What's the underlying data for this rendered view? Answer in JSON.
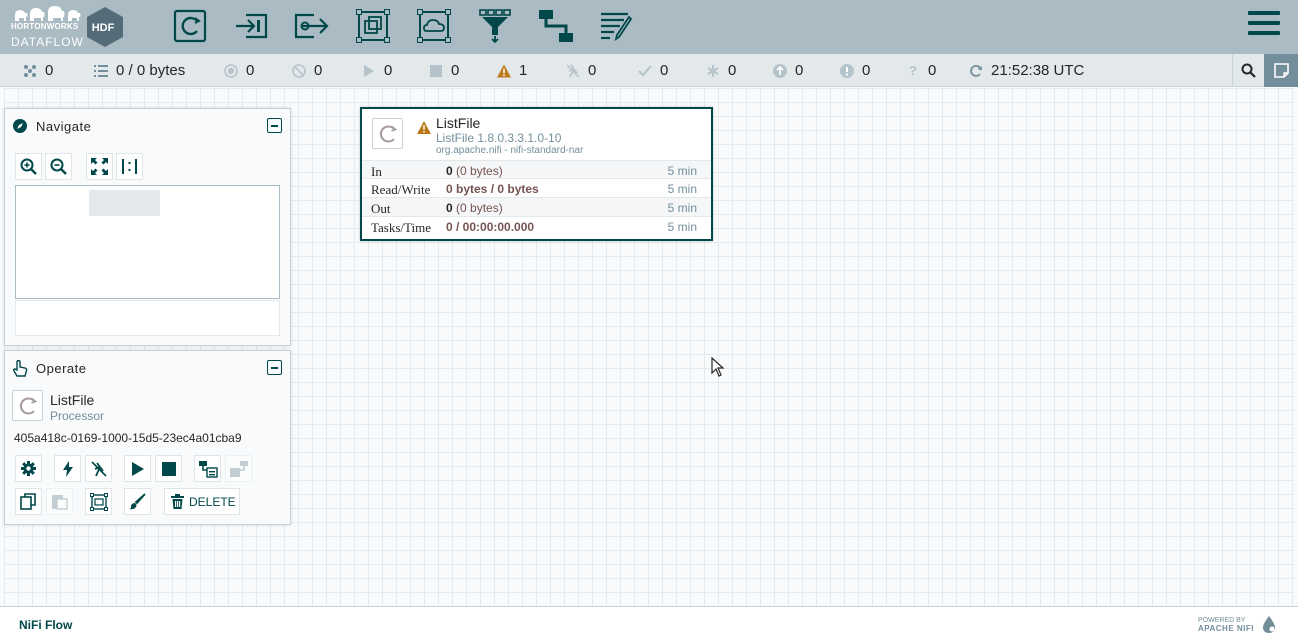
{
  "header": {
    "logo_company": "HORTONWORKS",
    "logo_product": "DATAFLOW",
    "logo_badge": "HDF",
    "toolbar": [
      {
        "name": "processor-tool",
        "icon": "processor-icon"
      },
      {
        "name": "input-port-tool",
        "icon": "input-port-icon"
      },
      {
        "name": "output-port-tool",
        "icon": "output-port-icon"
      },
      {
        "name": "process-group-tool",
        "icon": "process-group-icon"
      },
      {
        "name": "remote-process-group-tool",
        "icon": "remote-process-group-icon"
      },
      {
        "name": "funnel-tool",
        "icon": "funnel-icon"
      },
      {
        "name": "template-tool",
        "icon": "template-icon"
      },
      {
        "name": "label-tool",
        "icon": "label-icon"
      }
    ]
  },
  "status": {
    "transmitting_threads": "0",
    "queued": "0 / 0 bytes",
    "transmitting": "0",
    "not_transmitting": "0",
    "running": "0",
    "stopped": "0",
    "invalid": "1",
    "disabled": "0",
    "up_to_date": "0",
    "locally_modified": "0",
    "stale": "0",
    "locally_modified_stale": "0",
    "sync_failure": "0",
    "refresh_time": "21:52:38 UTC"
  },
  "navigate": {
    "title": "Navigate"
  },
  "operate": {
    "title": "Operate",
    "selected_name": "ListFile",
    "selected_type": "Processor",
    "selected_id": "405a418c-0169-1000-15d5-23ec4a01cba9",
    "delete_label": "DELETE"
  },
  "processor": {
    "name": "ListFile",
    "type": "ListFile 1.8.0.3.3.1.0-10",
    "bundle": "org.apache.nifi - nifi-standard-nar",
    "rows": [
      {
        "label": "In",
        "count": "0",
        "detail": " (0 bytes)",
        "time": "5 min"
      },
      {
        "label": "Read/Write",
        "count": "0 bytes / 0 bytes",
        "detail": "",
        "time": "5 min"
      },
      {
        "label": "Out",
        "count": "0",
        "detail": " (0 bytes)",
        "time": "5 min"
      },
      {
        "label": "Tasks/Time",
        "count": "0 / 00:00:00.000",
        "detail": "",
        "time": "5 min"
      }
    ]
  },
  "footer": {
    "breadcrumb": "NiFi Flow",
    "powered_by": "POWERED BY",
    "powered_name": "APACHE NIFI"
  },
  "colors": {
    "header_bg": "#aabbc3",
    "accent": "#004849",
    "status_bg": "#e3e8eb",
    "warning": "#ba7a1c",
    "muted": "#728e9b"
  }
}
